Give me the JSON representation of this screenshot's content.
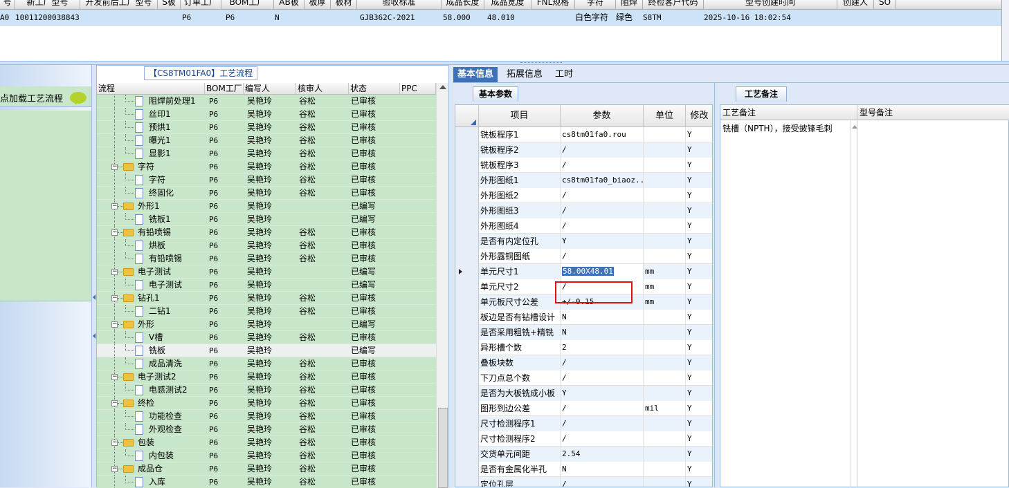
{
  "top_grid": {
    "headers": [
      "号",
      "新工厂型号",
      "开发前后工厂型号",
      "S板",
      "订单工厂",
      "BOM工厂",
      "AB板",
      "板厚",
      "板材",
      "验收标准",
      "成品长度",
      "成品宽度",
      "FNL规格",
      "字符",
      "阻焊",
      "终检客户代码",
      "型号创建时间",
      "创建人",
      "SO"
    ],
    "row": {
      "c0": "A0",
      "c1": "10011200038843",
      "c2": "P6",
      "c3": "P6",
      "c4": "N",
      "c5": "GJB362C-2021",
      "c6": "58.000",
      "c7": "48.010",
      "c8": "白色字符",
      "c9": "绿色",
      "c10": "S8TM",
      "c11": "2025-10-16 18:02:54"
    }
  },
  "left": {
    "load_label": "点加载工艺流程"
  },
  "flow": {
    "title": "【CS8TM01FA0】工艺流程",
    "headers": {
      "flow": "流程",
      "bom": "BOM工厂",
      "writer": "编写人",
      "reviewer": "核审人",
      "status": "状态",
      "ppc": "PPC"
    },
    "rows": [
      {
        "name": "阻焊前处理1",
        "level": 2,
        "bom": "P6",
        "writer": "吴艳玲",
        "reviewer": "谷松",
        "status": "已审核"
      },
      {
        "name": "丝印1",
        "level": 2,
        "bom": "P6",
        "writer": "吴艳玲",
        "reviewer": "谷松",
        "status": "已审核"
      },
      {
        "name": "预烘1",
        "level": 2,
        "bom": "P6",
        "writer": "吴艳玲",
        "reviewer": "谷松",
        "status": "已审核"
      },
      {
        "name": "曝光1",
        "level": 2,
        "bom": "P6",
        "writer": "吴艳玲",
        "reviewer": "谷松",
        "status": "已审核"
      },
      {
        "name": "显影1",
        "level": 2,
        "bom": "P6",
        "writer": "吴艳玲",
        "reviewer": "谷松",
        "status": "已审核"
      },
      {
        "name": "字符",
        "level": 1,
        "bom": "P6",
        "writer": "吴艳玲",
        "reviewer": "谷松",
        "status": "已审核"
      },
      {
        "name": "字符",
        "level": 2,
        "bom": "P6",
        "writer": "吴艳玲",
        "reviewer": "谷松",
        "status": "已审核"
      },
      {
        "name": "终固化",
        "level": 2,
        "bom": "P6",
        "writer": "吴艳玲",
        "reviewer": "谷松",
        "status": "已审核"
      },
      {
        "name": "外形1",
        "level": 1,
        "bom": "P6",
        "writer": "吴艳玲",
        "reviewer": "",
        "status": "已编写"
      },
      {
        "name": "铣板1",
        "level": 2,
        "bom": "P6",
        "writer": "吴艳玲",
        "reviewer": "",
        "status": "已编写"
      },
      {
        "name": "有铅喷锡",
        "level": 1,
        "bom": "P6",
        "writer": "吴艳玲",
        "reviewer": "谷松",
        "status": "已审核"
      },
      {
        "name": "烘板",
        "level": 2,
        "bom": "P6",
        "writer": "吴艳玲",
        "reviewer": "谷松",
        "status": "已审核"
      },
      {
        "name": "有铅喷锡",
        "level": 2,
        "bom": "P6",
        "writer": "吴艳玲",
        "reviewer": "谷松",
        "status": "已审核"
      },
      {
        "name": "电子测试",
        "level": 1,
        "bom": "P6",
        "writer": "吴艳玲",
        "reviewer": "",
        "status": "已编写"
      },
      {
        "name": "电子测试",
        "level": 2,
        "bom": "P6",
        "writer": "吴艳玲",
        "reviewer": "",
        "status": "已编写"
      },
      {
        "name": "钻孔1",
        "level": 1,
        "bom": "P6",
        "writer": "吴艳玲",
        "reviewer": "谷松",
        "status": "已审核"
      },
      {
        "name": "二钻1",
        "level": 2,
        "bom": "P6",
        "writer": "吴艳玲",
        "reviewer": "谷松",
        "status": "已审核"
      },
      {
        "name": "外形",
        "level": 1,
        "bom": "P6",
        "writer": "吴艳玲",
        "reviewer": "",
        "status": "已编写"
      },
      {
        "name": "V槽",
        "level": 2,
        "bom": "P6",
        "writer": "吴艳玲",
        "reviewer": "谷松",
        "status": "已审核"
      },
      {
        "name": "铣板",
        "level": 2,
        "bom": "P6",
        "writer": "吴艳玲",
        "reviewer": "",
        "status": "已编写",
        "selected": true
      },
      {
        "name": "成品清洗",
        "level": 2,
        "bom": "P6",
        "writer": "吴艳玲",
        "reviewer": "谷松",
        "status": "已审核"
      },
      {
        "name": "电子测试2",
        "level": 1,
        "bom": "P6",
        "writer": "吴艳玲",
        "reviewer": "谷松",
        "status": "已审核"
      },
      {
        "name": "电感测试2",
        "level": 2,
        "bom": "P6",
        "writer": "吴艳玲",
        "reviewer": "谷松",
        "status": "已审核"
      },
      {
        "name": "终检",
        "level": 1,
        "bom": "P6",
        "writer": "吴艳玲",
        "reviewer": "谷松",
        "status": "已审核"
      },
      {
        "name": "功能检查",
        "level": 2,
        "bom": "P6",
        "writer": "吴艳玲",
        "reviewer": "谷松",
        "status": "已审核"
      },
      {
        "name": "外观检查",
        "level": 2,
        "bom": "P6",
        "writer": "吴艳玲",
        "reviewer": "谷松",
        "status": "已审核"
      },
      {
        "name": "包装",
        "level": 1,
        "bom": "P6",
        "writer": "吴艳玲",
        "reviewer": "谷松",
        "status": "已审核"
      },
      {
        "name": "内包装",
        "level": 2,
        "bom": "P6",
        "writer": "吴艳玲",
        "reviewer": "谷松",
        "status": "已审核"
      },
      {
        "name": "成品仓",
        "level": 1,
        "bom": "P6",
        "writer": "吴艳玲",
        "reviewer": "谷松",
        "status": "已审核"
      },
      {
        "name": "入库",
        "level": 2,
        "bom": "P6",
        "writer": "吴艳玲",
        "reviewer": "谷松",
        "status": "已审核"
      }
    ]
  },
  "tabs": [
    "基本信息",
    "拓展信息",
    "工时"
  ],
  "basic": {
    "title": "基本参数",
    "headers": {
      "item": "项目",
      "param": "参数",
      "unit": "单位",
      "mod": "修改"
    },
    "rows": [
      {
        "name": "铣板程序1",
        "val": "cs8tm01fa0.rou",
        "unit": "",
        "mod": "Y"
      },
      {
        "name": "铣板程序2",
        "val": "/",
        "unit": "",
        "mod": "Y"
      },
      {
        "name": "铣板程序3",
        "val": "/",
        "unit": "",
        "mod": "Y"
      },
      {
        "name": "外形图纸1",
        "val": "cs8tm01fa0_biaoz...",
        "unit": "",
        "mod": "Y"
      },
      {
        "name": "外形图纸2",
        "val": "/",
        "unit": "",
        "mod": "Y"
      },
      {
        "name": "外形图纸3",
        "val": "/",
        "unit": "",
        "mod": "Y"
      },
      {
        "name": "外形图纸4",
        "val": "/",
        "unit": "",
        "mod": "Y"
      },
      {
        "name": "是否有内定位孔",
        "val": "Y",
        "unit": "",
        "mod": "Y"
      },
      {
        "name": "外形露铜图纸",
        "val": "/",
        "unit": "",
        "mod": "Y"
      },
      {
        "name": "单元尺寸1",
        "val": "58.00X48.01",
        "unit": "mm",
        "mod": "Y",
        "current": true
      },
      {
        "name": "单元尺寸2",
        "val": "/",
        "unit": "mm",
        "mod": "Y"
      },
      {
        "name": "单元板尺寸公差",
        "val": "+/-0.15",
        "unit": "mm",
        "mod": "Y"
      },
      {
        "name": "板边是否有钻槽设计",
        "val": "N",
        "unit": "",
        "mod": "Y"
      },
      {
        "name": "是否采用粗铣+精铣",
        "val": "N",
        "unit": "",
        "mod": "Y"
      },
      {
        "name": "异形槽个数",
        "val": "2",
        "unit": "",
        "mod": "Y"
      },
      {
        "name": "叠板块数",
        "val": "/",
        "unit": "",
        "mod": "Y"
      },
      {
        "name": "下刀点总个数",
        "val": "/",
        "unit": "",
        "mod": "Y"
      },
      {
        "name": "是否为大板铣成小板",
        "val": "Y",
        "unit": "",
        "mod": "Y"
      },
      {
        "name": "图形到边公差",
        "val": "/",
        "unit": "mil",
        "mod": "Y"
      },
      {
        "name": "尺寸检测程序1",
        "val": "/",
        "unit": "",
        "mod": "Y"
      },
      {
        "name": "尺寸检测程序2",
        "val": "/",
        "unit": "",
        "mod": "Y"
      },
      {
        "name": "交货单元间距",
        "val": "2.54",
        "unit": "",
        "mod": "Y"
      },
      {
        "name": "是否有金属化半孔",
        "val": "N",
        "unit": "",
        "mod": "Y"
      },
      {
        "name": "定位孔层",
        "val": "/",
        "unit": "",
        "mod": "Y"
      }
    ]
  },
  "notes": {
    "title": "工艺备注",
    "headers": {
      "process": "工艺备注",
      "model": "型号备注"
    },
    "process_text": "铣槽（NPTH），接受披锋毛刺"
  }
}
